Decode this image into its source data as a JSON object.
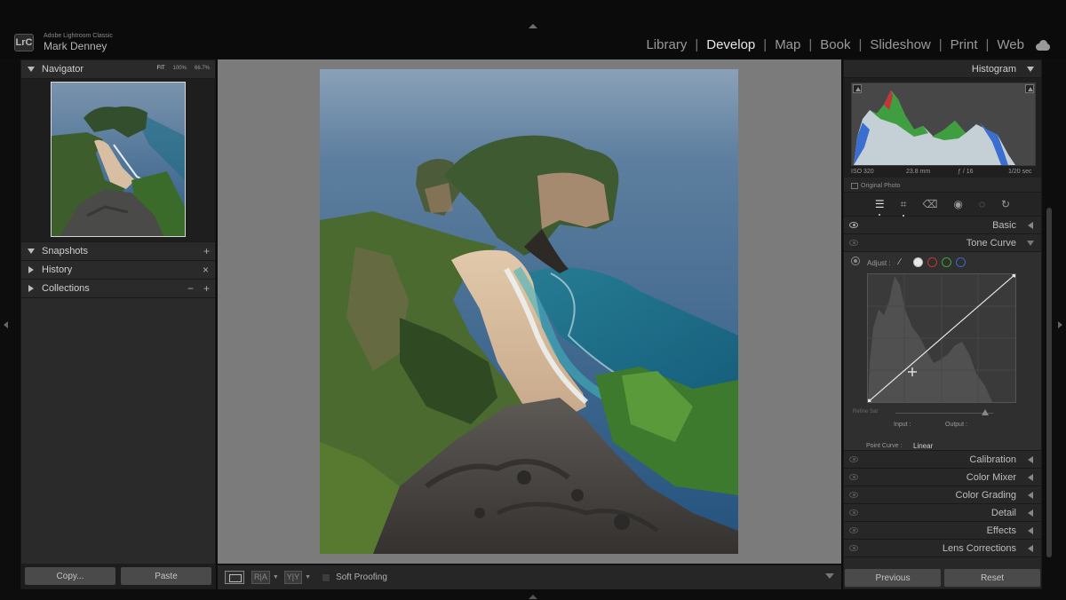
{
  "app": {
    "product": "Adobe Lightroom Classic",
    "user": "Mark Denney",
    "logo": "LrC"
  },
  "modules": [
    {
      "label": "Library",
      "active": false
    },
    {
      "label": "Develop",
      "active": true
    },
    {
      "label": "Map",
      "active": false
    },
    {
      "label": "Book",
      "active": false
    },
    {
      "label": "Slideshow",
      "active": false
    },
    {
      "label": "Print",
      "active": false
    },
    {
      "label": "Web",
      "active": false
    }
  ],
  "left": {
    "navigator": {
      "title": "Navigator",
      "zoom": [
        "FIT",
        "100%",
        "66.7%"
      ]
    },
    "snapshots": "Snapshots",
    "history": "History",
    "collections": "Collections",
    "copy": "Copy...",
    "paste": "Paste"
  },
  "toolbar": {
    "soft_proofing": "Soft Proofing",
    "ra": "R|A",
    "yy": "Y|Y"
  },
  "right": {
    "histogram": {
      "title": "Histogram",
      "iso": "ISO 320",
      "focal": "23.8 mm",
      "aperture": "ƒ / 16",
      "shutter": "1/20 sec",
      "original": "Original Photo"
    },
    "basic": "Basic",
    "tone_curve": {
      "title": "Tone Curve",
      "adjust": "Adjust :",
      "refine": "Refine Sat",
      "input": "Input :",
      "output": "Output :",
      "point_curve_label": "Point Curve :",
      "point_curve_value": "Linear"
    },
    "sections": [
      "Calibration",
      "Color Mixer",
      "Color Grading",
      "Detail",
      "Effects",
      "Lens Corrections"
    ],
    "previous": "Previous",
    "reset": "Reset"
  },
  "colors": {
    "accent": "#e6e6e6",
    "red_channel": "#c43535",
    "green_channel": "#3aa53a",
    "blue_channel": "#3868c9"
  }
}
